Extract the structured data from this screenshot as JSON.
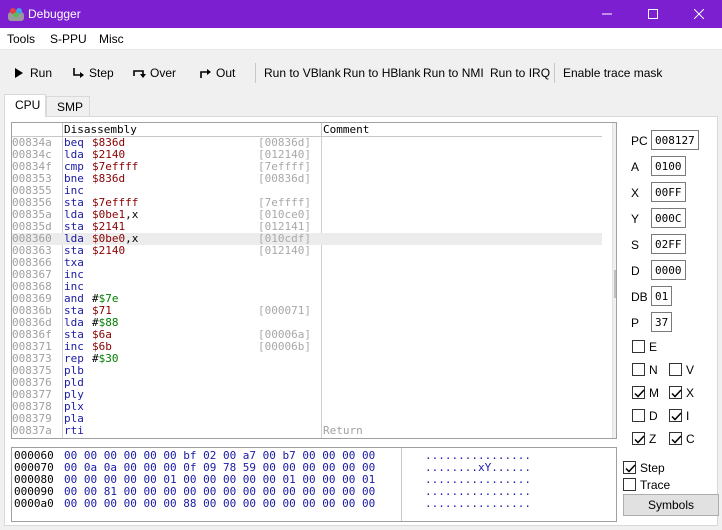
{
  "window": {
    "title": "Debugger"
  },
  "menu": [
    "Tools",
    "S-PPU",
    "Misc"
  ],
  "toolbar": {
    "run": "Run",
    "step": "Step",
    "over": "Over",
    "out": "Out",
    "run_vblank": "Run to VBlank",
    "run_hblank": "Run to HBlank",
    "run_nmi": "Run to NMI",
    "run_irq": "Run to IRQ",
    "trace": "Enable trace mask"
  },
  "tabs": [
    "CPU",
    "SMP"
  ],
  "disasm": {
    "col_disassembly": "Disassembly",
    "col_comment": "Comment",
    "rows": [
      {
        "addr": "00834a",
        "op": "beq",
        "arg": "$836d",
        "argcolor": "red",
        "eff": "[00836d]",
        "cmt": ""
      },
      {
        "addr": "00834c",
        "op": "lda",
        "arg": "$2140",
        "argcolor": "red",
        "eff": "[012140]",
        "cmt": ""
      },
      {
        "addr": "00834f",
        "op": "cmp",
        "arg": "$7effff",
        "argcolor": "red",
        "eff": "[7effff]",
        "cmt": ""
      },
      {
        "addr": "008353",
        "op": "bne",
        "arg": "$836d",
        "argcolor": "red",
        "eff": "[00836d]",
        "cmt": ""
      },
      {
        "addr": "008355",
        "op": "inc",
        "arg": "",
        "argcolor": "red",
        "eff": "",
        "cmt": ""
      },
      {
        "addr": "008356",
        "op": "sta",
        "arg": "$7effff",
        "argcolor": "red",
        "eff": "[7effff]",
        "cmt": ""
      },
      {
        "addr": "00835a",
        "op": "lda",
        "arg": "$0be1,x",
        "argcolor": "red",
        "eff": "[010ce0]",
        "cmt": ""
      },
      {
        "addr": "00835d",
        "op": "sta",
        "arg": "$2141",
        "argcolor": "red",
        "eff": "[012141]",
        "cmt": ""
      },
      {
        "addr": "008360",
        "op": "lda",
        "arg": "$0be0,x",
        "argcolor": "red",
        "eff": "[010cdf]",
        "cmt": "",
        "hl": true
      },
      {
        "addr": "008363",
        "op": "sta",
        "arg": "$2140",
        "argcolor": "red",
        "eff": "[012140]",
        "cmt": ""
      },
      {
        "addr": "008366",
        "op": "txa",
        "arg": "",
        "argcolor": "red",
        "eff": "",
        "cmt": ""
      },
      {
        "addr": "008367",
        "op": "inc",
        "arg": "",
        "argcolor": "red",
        "eff": "",
        "cmt": ""
      },
      {
        "addr": "008368",
        "op": "inc",
        "arg": "",
        "argcolor": "red",
        "eff": "",
        "cmt": ""
      },
      {
        "addr": "008369",
        "op": "and",
        "arg": "#$7e",
        "argcolor": "green",
        "eff": "",
        "cmt": ""
      },
      {
        "addr": "00836b",
        "op": "sta",
        "arg": "$71",
        "argcolor": "red",
        "eff": "[000071]",
        "cmt": ""
      },
      {
        "addr": "00836d",
        "op": "lda",
        "arg": "#$88",
        "argcolor": "green",
        "eff": "",
        "cmt": ""
      },
      {
        "addr": "00836f",
        "op": "sta",
        "arg": "$6a",
        "argcolor": "red",
        "eff": "[00006a]",
        "cmt": ""
      },
      {
        "addr": "008371",
        "op": "inc",
        "arg": "$6b",
        "argcolor": "red",
        "eff": "[00006b]",
        "cmt": ""
      },
      {
        "addr": "008373",
        "op": "rep",
        "arg": "#$30",
        "argcolor": "green",
        "eff": "",
        "cmt": ""
      },
      {
        "addr": "008375",
        "op": "plb",
        "arg": "",
        "argcolor": "red",
        "eff": "",
        "cmt": ""
      },
      {
        "addr": "008376",
        "op": "pld",
        "arg": "",
        "argcolor": "red",
        "eff": "",
        "cmt": ""
      },
      {
        "addr": "008377",
        "op": "ply",
        "arg": "",
        "argcolor": "red",
        "eff": "",
        "cmt": ""
      },
      {
        "addr": "008378",
        "op": "plx",
        "arg": "",
        "argcolor": "red",
        "eff": "",
        "cmt": ""
      },
      {
        "addr": "008379",
        "op": "pla",
        "arg": "",
        "argcolor": "red",
        "eff": "",
        "cmt": ""
      },
      {
        "addr": "00837a",
        "op": "rti",
        "arg": "",
        "argcolor": "red",
        "eff": "",
        "cmt": "Return"
      }
    ]
  },
  "registers": [
    {
      "name": "PC",
      "value": "008127"
    },
    {
      "name": "A",
      "value": "0100"
    },
    {
      "name": "X",
      "value": "00FF"
    },
    {
      "name": "Y",
      "value": "000C"
    },
    {
      "name": "S",
      "value": "02FF"
    },
    {
      "name": "D",
      "value": "0000"
    },
    {
      "name": "DB",
      "value": "01"
    },
    {
      "name": "P",
      "value": "37"
    }
  ],
  "flags": [
    {
      "name": "E",
      "checked": false
    },
    {
      "name": "N",
      "checked": false
    },
    {
      "name": "V",
      "checked": false
    },
    {
      "name": "M",
      "checked": true
    },
    {
      "name": "X",
      "checked": true
    },
    {
      "name": "D",
      "checked": false
    },
    {
      "name": "I",
      "checked": true
    },
    {
      "name": "Z",
      "checked": true
    },
    {
      "name": "C",
      "checked": true
    }
  ],
  "options": {
    "step": {
      "label": "Step",
      "checked": true
    },
    "trace": {
      "label": "Trace",
      "checked": false
    },
    "symbols": "Symbols"
  },
  "memory": [
    {
      "addr": "000060",
      "hex": "00 00 00 00 00 00 bf 02 00 a7 00 b7 00 00 00 00",
      "ascii": "................"
    },
    {
      "addr": "000070",
      "hex": "00 0a 0a 00 00 00 0f 09 78 59 00 00 00 00 00 00",
      "ascii": "........xY......"
    },
    {
      "addr": "000080",
      "hex": "00 00 00 00 00 01 00 00 00 00 00 01 00 00 00 01",
      "ascii": "................"
    },
    {
      "addr": "000090",
      "hex": "00 00 81 00 00 00 00 00 00 00 00 00 00 00 00 00",
      "ascii": "................"
    },
    {
      "addr": "0000a0",
      "hex": "00 00 00 00 00 00 88 00 00 00 00 00 00 00 00 00",
      "ascii": "................"
    }
  ]
}
